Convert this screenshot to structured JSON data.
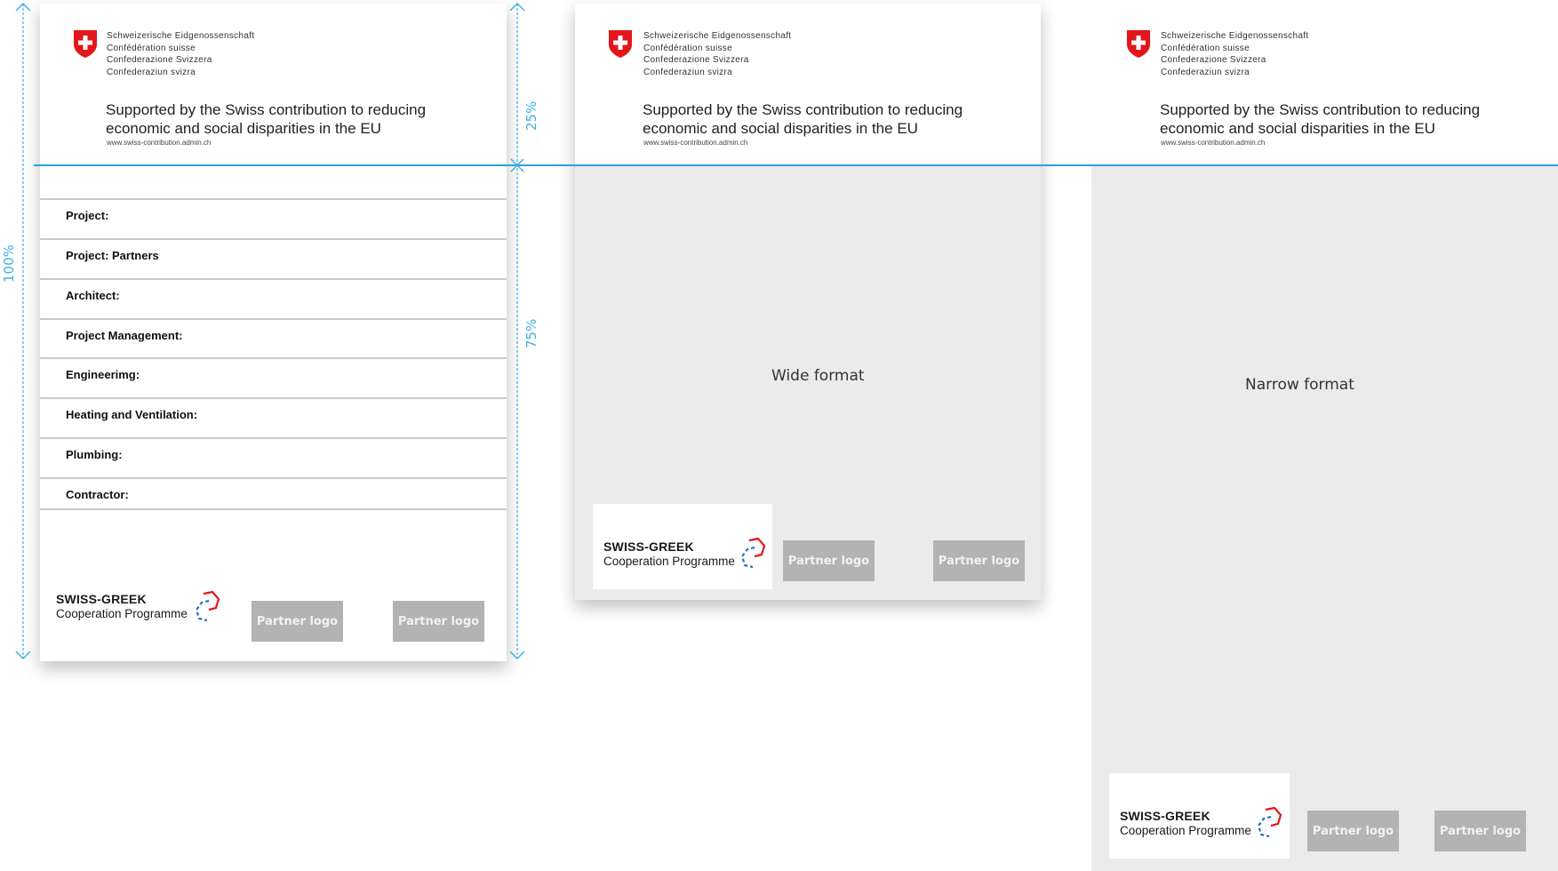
{
  "emblem_block": {
    "lines": [
      "Schweizerische Eidgenossenschaft",
      "Confédération suisse",
      "Confederazione Svizzera",
      "Confederaziun svizra"
    ]
  },
  "tagline": {
    "line1": "Supported by the Swiss contribution to reducing",
    "line2": "economic and social disparities in the EU",
    "url": "www.swiss-contribution.admin.ch"
  },
  "info_rows": [
    {
      "label": "Project:"
    },
    {
      "label": "Project:  Partners"
    },
    {
      "label": "Architect:"
    },
    {
      "label": "Project Management:"
    },
    {
      "label": "Engineerimg:"
    },
    {
      "label": "Heating and Ventilation:"
    },
    {
      "label": "Plumbing:"
    },
    {
      "label": "Contractor:"
    }
  ],
  "programme": {
    "title": "SWISS-GREEK",
    "subtitle": "Cooperation Programme"
  },
  "partner_label": "Partner logo",
  "formats": {
    "wide": "Wide format",
    "narrow": "Narrow format"
  },
  "dimensions": {
    "total": "100%",
    "top": "25%",
    "bottom": "75%"
  },
  "colors": {
    "swiss_red": "#e3161b",
    "guide_blue": "#29a3dc",
    "partner_grey": "#b3b3b3",
    "body_grey": "#ebebeb"
  },
  "icons": [
    "swiss-cross-icon",
    "swiss-greek-mark-icon",
    "arrow-up-icon",
    "arrow-down-icon"
  ]
}
